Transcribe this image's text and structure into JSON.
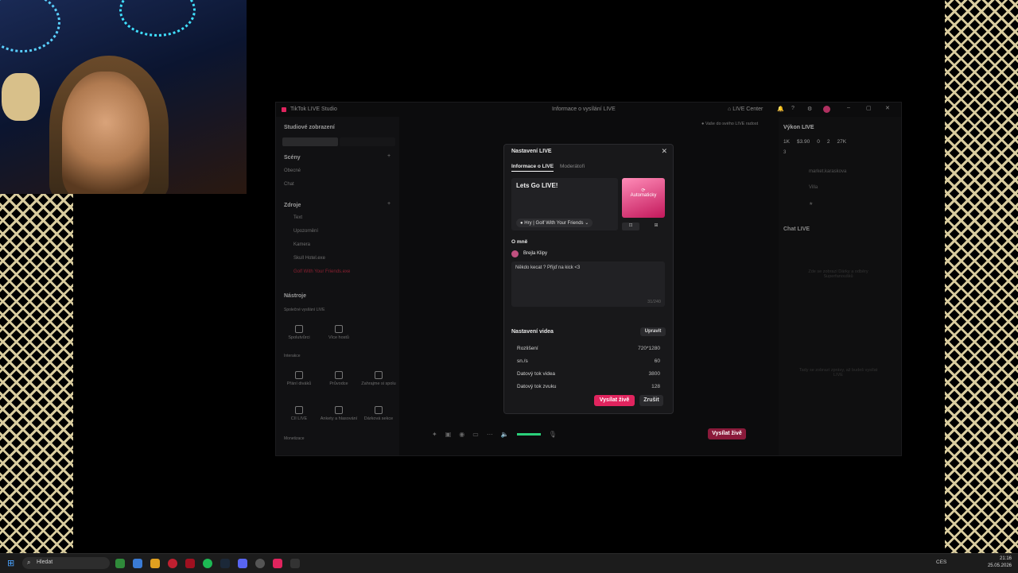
{
  "app": {
    "title": "TikTok LIVE Studio",
    "center_title": "Informace o vysílání LIVE",
    "live_center": "LIVE Center",
    "hint": "Vaše do svého LIVE radost"
  },
  "sidebar": {
    "view": "Studiové zobrazení",
    "scenes_header": "Scény",
    "scenes": [
      "Obecné",
      "Chat"
    ],
    "sources_header": "Zdroje",
    "sources": [
      "Text",
      "Upozornění",
      "Kamera",
      "Skull Hotel.exe",
      "Golf With Your Friends.exe"
    ],
    "tools_header": "Nástroje",
    "tools_sub1": "Společné vysílání LIVE",
    "tools_row1": [
      "Spolutvůrci",
      "Více hostů"
    ],
    "tools_sub2": "Interakce",
    "tools_row2": [
      "Přání diváků",
      "Průvodce",
      "Zahrajme si spolu"
    ],
    "tools_row3": [
      "CII LIVE",
      "Ankety a hlasování",
      "Dárková sekce"
    ],
    "tools_sub3": "Monetizace"
  },
  "right_panel": {
    "performance_title": "Výkon LIVE",
    "stats": [
      "1K",
      "$3.90",
      "0",
      "2",
      "27K"
    ],
    "viewers_count": "3",
    "viewers": [
      "market.karaskova",
      "Villa",
      "★"
    ],
    "chat_title": "Chat LIVE",
    "chat_empty1": "Zde se zobrazí Dárky a odběry Superfanoušků",
    "chat_empty2": "Tady se zobrazí zprávy, až budeš vysílat LIVE"
  },
  "modal": {
    "title": "Nastavení LIVE",
    "tabs": [
      "Informace o LIVE",
      "Moderátoři"
    ],
    "live_title": "Lets Go LIVE!",
    "category": "Hry | Golf With Your Friends",
    "cover_label": "Automaticky",
    "about_header": "O mně",
    "username": "Brejla Klipy",
    "bio": "Někdo kecat ? Přijď na kick <3",
    "bio_counter": "31/240",
    "video_header": "Nastavení videa",
    "edit_button": "Upravit",
    "settings": [
      {
        "label": "Rozlišení",
        "value": "720*1280"
      },
      {
        "label": "sn./s",
        "value": "60"
      },
      {
        "label": "Datový tok videa",
        "value": "3800"
      },
      {
        "label": "Datový tok zvuku",
        "value": "128"
      }
    ],
    "go_live": "Vysílat živě",
    "cancel": "Zrušit"
  },
  "bottom_toolbar": {
    "go_live": "Vysílat živě"
  },
  "taskbar": {
    "search": "Hledat",
    "time": "21:16",
    "date": "25.05.2026",
    "lang": "CES"
  }
}
